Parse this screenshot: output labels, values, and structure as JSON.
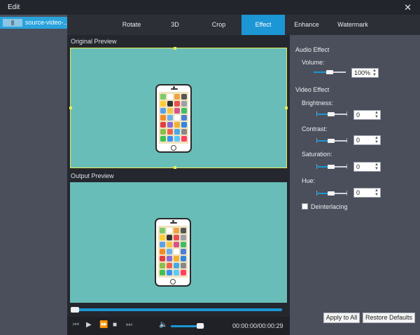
{
  "window": {
    "title": "Edit"
  },
  "sidebar": {
    "file_name": "source-video-..."
  },
  "tabs": [
    {
      "label": "Rotate"
    },
    {
      "label": "3D"
    },
    {
      "label": "Crop"
    },
    {
      "label": "Effect",
      "active": true
    },
    {
      "label": "Enhance"
    },
    {
      "label": "Watermark"
    }
  ],
  "preview": {
    "original_label": "Original Preview",
    "output_label": "Output Preview",
    "video_bg_color": "#69bdb9",
    "timeline_progress": 0.02,
    "timecode": "00:00:00/00:00:29",
    "volume_level": 0.8
  },
  "audio_effect": {
    "heading": "Audio Effect",
    "volume_label": "Volume:",
    "volume_value": "100%"
  },
  "video_effect": {
    "heading": "Video Effect",
    "brightness_label": "Brightness:",
    "brightness_value": "0",
    "contrast_label": "Contrast:",
    "contrast_value": "0",
    "saturation_label": "Saturation:",
    "saturation_value": "0",
    "hue_label": "Hue:",
    "hue_value": "0",
    "deinterlacing_label": "Deinterlacing",
    "deinterlacing_checked": false
  },
  "buttons": {
    "apply_all": "Apply to All",
    "restore_defaults": "Restore Defaults"
  },
  "colors": {
    "accent": "#1c96d4",
    "selection_border": "#e8ec52"
  }
}
